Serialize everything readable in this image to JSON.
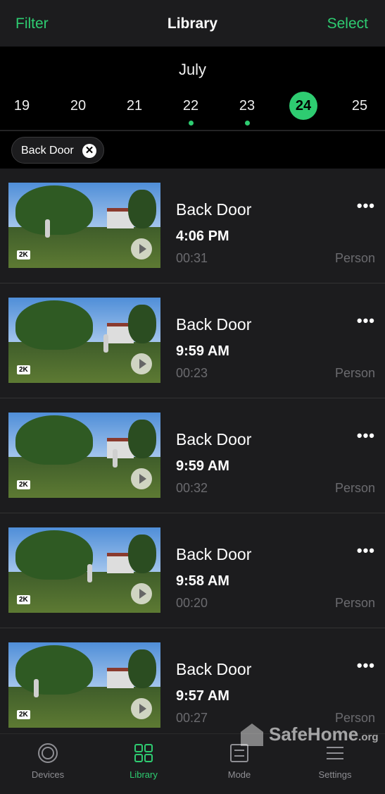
{
  "header": {
    "filter_label": "Filter",
    "title": "Library",
    "select_label": "Select"
  },
  "calendar": {
    "month": "July",
    "days": [
      {
        "label": "19",
        "has_event": false,
        "selected": false
      },
      {
        "label": "20",
        "has_event": false,
        "selected": false
      },
      {
        "label": "21",
        "has_event": false,
        "selected": false
      },
      {
        "label": "22",
        "has_event": true,
        "selected": false
      },
      {
        "label": "23",
        "has_event": true,
        "selected": false
      },
      {
        "label": "24",
        "has_event": false,
        "selected": true
      },
      {
        "label": "25",
        "has_event": false,
        "selected": false
      }
    ]
  },
  "filter_chip": {
    "label": "Back Door",
    "remove_icon": "close-circle-icon"
  },
  "clips": [
    {
      "camera": "Back Door",
      "time": "4:06 PM",
      "duration": "00:31",
      "tag": "Person",
      "badge": "2K"
    },
    {
      "camera": "Back Door",
      "time": "9:59 AM",
      "duration": "00:23",
      "tag": "Person",
      "badge": "2K"
    },
    {
      "camera": "Back Door",
      "time": "9:59 AM",
      "duration": "00:32",
      "tag": "Person",
      "badge": "2K"
    },
    {
      "camera": "Back Door",
      "time": "9:58 AM",
      "duration": "00:20",
      "tag": "Person",
      "badge": "2K"
    },
    {
      "camera": "Back Door",
      "time": "9:57 AM",
      "duration": "00:27",
      "tag": "Person",
      "badge": "2K"
    }
  ],
  "more_glyph": "•••",
  "tabs": [
    {
      "label": "Devices",
      "icon": "camera-lens-icon",
      "active": false
    },
    {
      "label": "Library",
      "icon": "grid-icon",
      "active": true
    },
    {
      "label": "Mode",
      "icon": "mode-sliders-icon",
      "active": false
    },
    {
      "label": "Settings",
      "icon": "menu-lines-icon",
      "active": false
    }
  ],
  "watermark": {
    "brand": "SafeHome",
    "suffix": ".org"
  },
  "colors": {
    "accent": "#2ecc71",
    "background": "#1c1c1e",
    "date_bar": "#000000",
    "muted_text": "#6b6b6f"
  }
}
